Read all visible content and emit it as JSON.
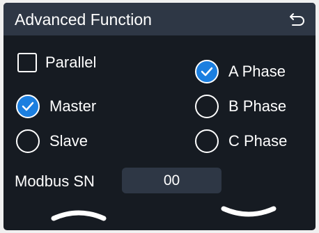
{
  "header": {
    "title": "Advanced Function",
    "back_icon": "return-arrow-icon"
  },
  "options": {
    "parallel": {
      "label": "Parallel",
      "checked": false
    },
    "master": {
      "label": "Master",
      "checked": true
    },
    "slave": {
      "label": "Slave",
      "checked": false
    },
    "a_phase": {
      "label": "A Phase",
      "checked": true
    },
    "b_phase": {
      "label": "B Phase",
      "checked": false
    },
    "c_phase": {
      "label": "C Phase",
      "checked": false
    }
  },
  "modbus": {
    "label": "Modbus SN",
    "value": "00"
  },
  "nav": {
    "up_icon": "chevron-up-icon",
    "down_icon": "chevron-down-icon"
  },
  "colors": {
    "background": "#161b22",
    "header": "#2e3745",
    "accent": "#1b7fe0"
  }
}
